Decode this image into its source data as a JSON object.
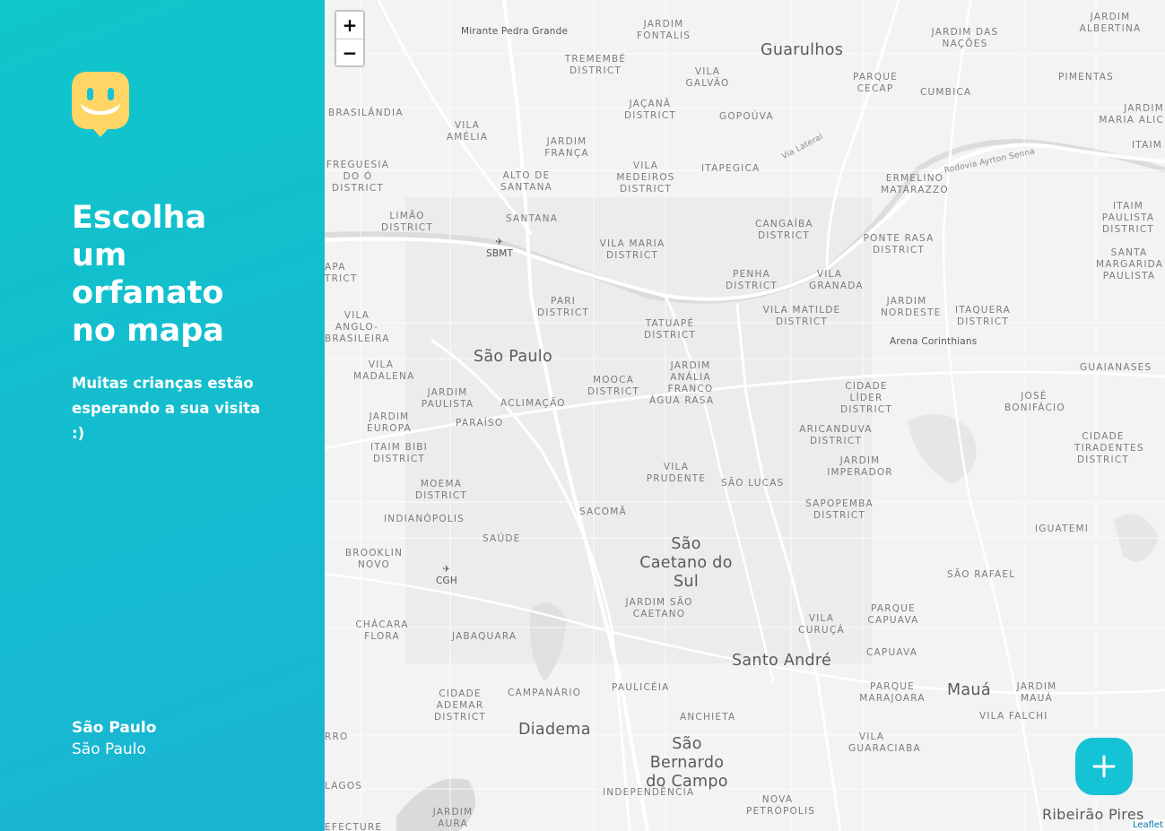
{
  "sidebar": {
    "logo_icon": "smiling-pin-logo",
    "headline": "Escolha um orfanato no mapa",
    "subtext": "Muitas crianças estão esperando a sua visita :)",
    "location": {
      "city": "São Paulo",
      "state": "São Paulo"
    },
    "colors": {
      "gradient_start": "#0fc6ca",
      "gradient_end": "#1ab4d3",
      "logo": "#ffd666"
    }
  },
  "map": {
    "zoom_in_label": "+",
    "zoom_out_label": "−",
    "add_button_icon": "plus-icon",
    "attribution": "Leaflet",
    "labels": {
      "mirante": "Mirante Pedra Grande",
      "guarulhos": "Guarulhos",
      "jardim_fontalis": "JARDIM FONTALIS",
      "tremembe": "TREMEMBÉ DISTRICT",
      "vila_galvao": "VILA GALVÃO",
      "parque_cecap": "PARQUE CECAP",
      "jardim_nacoes": "JARDIM DAS NAÇÕES",
      "jardim_albertina": "JARDIM ALBERTINA",
      "pimentas": "PIMENTAS",
      "cumbica": "CUMBICA",
      "jardim_maria": "JARDIM MARIA ALIC",
      "brasilandia": "BRASILÂNDIA",
      "jacana": "JAÇANÃ DISTRICT",
      "gopouva": "GOPOÚVA",
      "vila_amelia": "VILA AMÉLIA",
      "jardim_franca": "JARDIM FRANÇA",
      "itaim": "ITAIM",
      "via_lateral": "Via Lateral",
      "rodovia": "Rodovia Ayrton Senna",
      "freguesia": "FREGUESIA DO Ó DISTRICT",
      "alto_santana": "ALTO DE SANTANA",
      "vila_medeiros": "VILA MEDEIROS DISTRICT",
      "itapegica": "ITAPEGICA",
      "ermelino": "ERMELINO MATARAZZO",
      "itaim_paulista": "ITAIM PAULISTA DISTRICT",
      "limao": "LIMÃO DISTRICT",
      "santana": "SANTANA",
      "cangaiba": "CANGAÍBA DISTRICT",
      "ponte_rasa": "PONTE RASA DISTRICT",
      "sbmt": "SBMT",
      "vila_maria": "VILA MARIA DISTRICT",
      "santa_margarida": "SANTA MARGARIDA PAULISTA",
      "lapa": "APA",
      "rict": "TRICT",
      "penha": "PENHA DISTRICT",
      "vila_granada": "VILA GRANADA",
      "pari": "PARI DISTRICT",
      "jardim_nordeste": "JARDIM NORDESTE",
      "itaquera": "ITAQUERA DISTRICT",
      "vila_anglo": "VILA ANGLO-BRASILEIRA",
      "vila_matilde": "VILA MATILDE DISTRICT",
      "tatuape": "TATUAPÉ DISTRICT",
      "arena": "Arena Corinthians",
      "sao_paulo": "São Paulo",
      "vila_madalena": "VILA MADALENA",
      "jardim_analia": "JARDIM ANÁLIA FRANCO",
      "guaianases": "GUAIANASES",
      "mooca": "MOOCA DISTRICT",
      "jardim_paulista": "JARDIM PAULISTA",
      "aclimacao": "ACLIMAÇÃO",
      "cidade_lider": "CIDADE LÍDER DISTRICT",
      "jose_bonifacio": "JOSÉ BONIFÁCIO",
      "agua_rasa": "ÁGUA RASA",
      "jardim_europa": "JARDIM EUROPA",
      "paraiso": "PARAÍSO",
      "aricanduva": "ARICANDUVA DISTRICT",
      "cidade_tiradentes": "CIDADE TIRADENTES DISTRICT",
      "itaim_bibi": "ITAIM BIBI DISTRICT",
      "jardim_imperador": "JARDIM IMPERADOR",
      "vila_prudente": "VILA PRUDENTE",
      "moema": "MOEMA DISTRICT",
      "sao_lucas": "SÃO LUCAS",
      "sapopemba": "SAPOPEMBA DISTRICT",
      "indianopolis": "INDIANÓPOLIS",
      "sacoma": "SACOMÃ",
      "iguatemi": "IGUATEMI",
      "saude": "SAÚDE",
      "sao_caetano": "São Caetano do Sul",
      "brooklin": "BROOKLIN NOVO",
      "cgh": "CGH",
      "sao_rafael": "SÃO RAFAEL",
      "jardim_sao_caetano": "JARDIM SÃO CAETANO",
      "parque_capuava": "PARQUE CAPUAVA",
      "chacara_flora": "CHÁCARA FLORA",
      "jabaquara": "JABAQUARA",
      "vila_curuca": "VILA CURUÇÁ",
      "capuava": "CAPUAVA",
      "santo_andre": "Santo André",
      "cidade_ademar": "CIDADE ADEMAR DISTRICT",
      "campanario": "CAMPANÁRIO",
      "pauliceia": "PAULICÉIA",
      "parque_marajoara": "PARQUE MARAJOARA",
      "maua": "Mauá",
      "jardim_maua": "JARDIM MAUÁ",
      "vila_falchi": "VILA FALCHI",
      "diadema": "Diadema",
      "anchieta": "ANCHIETA",
      "rro": "RRO",
      "sao_bernardo": "São Bernardo do Campo",
      "vila_guaraciaba": "VILA GUARACIABA",
      "lagos": "LAGOS",
      "independencia": "INDEPENDÊNCIA",
      "nova_petropolis": "NOVA PETRÓPOLIS",
      "jardim_laura": "JARDIM AURA",
      "efecture": "EFECTURE",
      "ribeirao": "Ribeirão Pires"
    }
  }
}
